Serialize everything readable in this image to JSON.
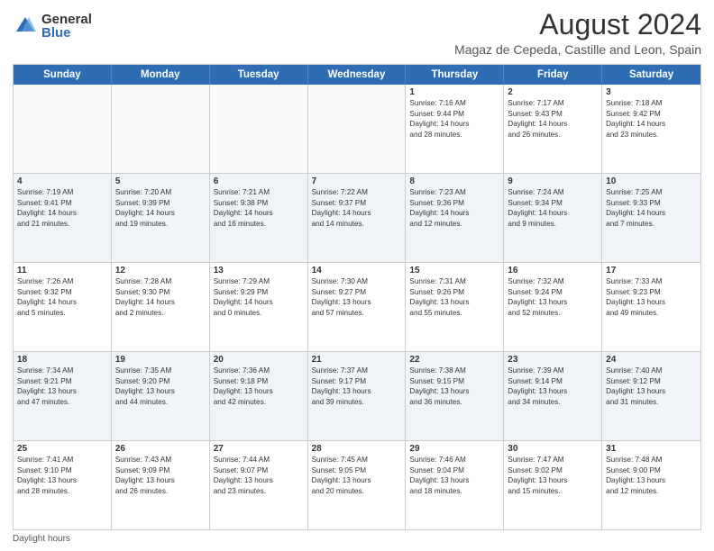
{
  "logo": {
    "general": "General",
    "blue": "Blue"
  },
  "title": "August 2024",
  "subtitle": "Magaz de Cepeda, Castille and Leon, Spain",
  "header_days": [
    "Sunday",
    "Monday",
    "Tuesday",
    "Wednesday",
    "Thursday",
    "Friday",
    "Saturday"
  ],
  "footer": "Daylight hours",
  "weeks": [
    [
      {
        "day": "",
        "info": ""
      },
      {
        "day": "",
        "info": ""
      },
      {
        "day": "",
        "info": ""
      },
      {
        "day": "",
        "info": ""
      },
      {
        "day": "1",
        "info": "Sunrise: 7:16 AM\nSunset: 9:44 PM\nDaylight: 14 hours\nand 28 minutes."
      },
      {
        "day": "2",
        "info": "Sunrise: 7:17 AM\nSunset: 9:43 PM\nDaylight: 14 hours\nand 26 minutes."
      },
      {
        "day": "3",
        "info": "Sunrise: 7:18 AM\nSunset: 9:42 PM\nDaylight: 14 hours\nand 23 minutes."
      }
    ],
    [
      {
        "day": "4",
        "info": "Sunrise: 7:19 AM\nSunset: 9:41 PM\nDaylight: 14 hours\nand 21 minutes."
      },
      {
        "day": "5",
        "info": "Sunrise: 7:20 AM\nSunset: 9:39 PM\nDaylight: 14 hours\nand 19 minutes."
      },
      {
        "day": "6",
        "info": "Sunrise: 7:21 AM\nSunset: 9:38 PM\nDaylight: 14 hours\nand 16 minutes."
      },
      {
        "day": "7",
        "info": "Sunrise: 7:22 AM\nSunset: 9:37 PM\nDaylight: 14 hours\nand 14 minutes."
      },
      {
        "day": "8",
        "info": "Sunrise: 7:23 AM\nSunset: 9:36 PM\nDaylight: 14 hours\nand 12 minutes."
      },
      {
        "day": "9",
        "info": "Sunrise: 7:24 AM\nSunset: 9:34 PM\nDaylight: 14 hours\nand 9 minutes."
      },
      {
        "day": "10",
        "info": "Sunrise: 7:25 AM\nSunset: 9:33 PM\nDaylight: 14 hours\nand 7 minutes."
      }
    ],
    [
      {
        "day": "11",
        "info": "Sunrise: 7:26 AM\nSunset: 9:32 PM\nDaylight: 14 hours\nand 5 minutes."
      },
      {
        "day": "12",
        "info": "Sunrise: 7:28 AM\nSunset: 9:30 PM\nDaylight: 14 hours\nand 2 minutes."
      },
      {
        "day": "13",
        "info": "Sunrise: 7:29 AM\nSunset: 9:29 PM\nDaylight: 14 hours\nand 0 minutes."
      },
      {
        "day": "14",
        "info": "Sunrise: 7:30 AM\nSunset: 9:27 PM\nDaylight: 13 hours\nand 57 minutes."
      },
      {
        "day": "15",
        "info": "Sunrise: 7:31 AM\nSunset: 9:26 PM\nDaylight: 13 hours\nand 55 minutes."
      },
      {
        "day": "16",
        "info": "Sunrise: 7:32 AM\nSunset: 9:24 PM\nDaylight: 13 hours\nand 52 minutes."
      },
      {
        "day": "17",
        "info": "Sunrise: 7:33 AM\nSunset: 9:23 PM\nDaylight: 13 hours\nand 49 minutes."
      }
    ],
    [
      {
        "day": "18",
        "info": "Sunrise: 7:34 AM\nSunset: 9:21 PM\nDaylight: 13 hours\nand 47 minutes."
      },
      {
        "day": "19",
        "info": "Sunrise: 7:35 AM\nSunset: 9:20 PM\nDaylight: 13 hours\nand 44 minutes."
      },
      {
        "day": "20",
        "info": "Sunrise: 7:36 AM\nSunset: 9:18 PM\nDaylight: 13 hours\nand 42 minutes."
      },
      {
        "day": "21",
        "info": "Sunrise: 7:37 AM\nSunset: 9:17 PM\nDaylight: 13 hours\nand 39 minutes."
      },
      {
        "day": "22",
        "info": "Sunrise: 7:38 AM\nSunset: 9:15 PM\nDaylight: 13 hours\nand 36 minutes."
      },
      {
        "day": "23",
        "info": "Sunrise: 7:39 AM\nSunset: 9:14 PM\nDaylight: 13 hours\nand 34 minutes."
      },
      {
        "day": "24",
        "info": "Sunrise: 7:40 AM\nSunset: 9:12 PM\nDaylight: 13 hours\nand 31 minutes."
      }
    ],
    [
      {
        "day": "25",
        "info": "Sunrise: 7:41 AM\nSunset: 9:10 PM\nDaylight: 13 hours\nand 28 minutes."
      },
      {
        "day": "26",
        "info": "Sunrise: 7:43 AM\nSunset: 9:09 PM\nDaylight: 13 hours\nand 26 minutes."
      },
      {
        "day": "27",
        "info": "Sunrise: 7:44 AM\nSunset: 9:07 PM\nDaylight: 13 hours\nand 23 minutes."
      },
      {
        "day": "28",
        "info": "Sunrise: 7:45 AM\nSunset: 9:05 PM\nDaylight: 13 hours\nand 20 minutes."
      },
      {
        "day": "29",
        "info": "Sunrise: 7:46 AM\nSunset: 9:04 PM\nDaylight: 13 hours\nand 18 minutes."
      },
      {
        "day": "30",
        "info": "Sunrise: 7:47 AM\nSunset: 9:02 PM\nDaylight: 13 hours\nand 15 minutes."
      },
      {
        "day": "31",
        "info": "Sunrise: 7:48 AM\nSunset: 9:00 PM\nDaylight: 13 hours\nand 12 minutes."
      }
    ]
  ]
}
